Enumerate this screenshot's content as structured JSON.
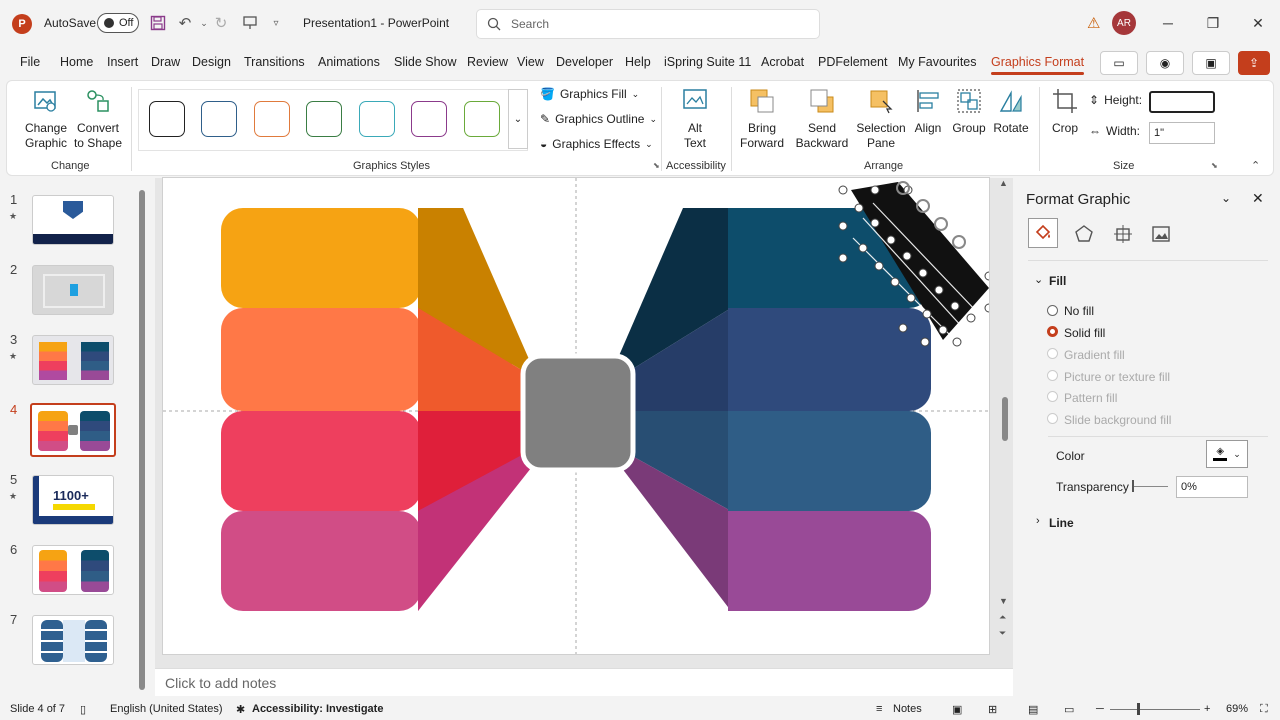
{
  "titlebar": {
    "autosave_label": "AutoSave",
    "autosave_state": "Off",
    "doc_title": "Presentation1 - PowerPoint",
    "search_placeholder": "Search",
    "user_initials": "AR"
  },
  "menu": {
    "tabs": [
      "File",
      "Home",
      "Insert",
      "Draw",
      "Design",
      "Transitions",
      "Animations",
      "Slide Show",
      "Review",
      "View",
      "Developer",
      "Help",
      "iSpring Suite 11",
      "Acrobat",
      "PDFelement",
      "My Favourites",
      "Graphics Format"
    ],
    "active_tab": "Graphics Format"
  },
  "ribbon": {
    "change": {
      "change_graphic": "Change Graphic",
      "convert": "Convert to Shape",
      "label": "Change"
    },
    "styles_label": "Graphics Styles",
    "style_colors": [
      "#222222",
      "#2f5f8a",
      "#e07a3c",
      "#3a7d44",
      "#3aa9b8",
      "#8b3a8b",
      "#6aaa3a"
    ],
    "fill_label": "Graphics Fill",
    "outline_label": "Graphics Outline",
    "effects_label": "Graphics Effects",
    "accessibility": {
      "alt_text": "Alt Text",
      "label": "Accessibility"
    },
    "arrange": {
      "bring_forward": "Bring Forward",
      "send_backward": "Send Backward",
      "selection_pane": "Selection Pane",
      "align": "Align",
      "group": "Group",
      "rotate": "Rotate",
      "label": "Arrange"
    },
    "size": {
      "crop": "Crop",
      "height_label": "Height:",
      "height_value": "",
      "width_label": "Width:",
      "width_value": "1\"",
      "label": "Size"
    }
  },
  "thumbnails": [
    {
      "num": "1",
      "star": true
    },
    {
      "num": "2",
      "star": false
    },
    {
      "num": "3",
      "star": true
    },
    {
      "num": "4",
      "star": false,
      "selected": true
    },
    {
      "num": "5",
      "star": true,
      "thumb_text": "1100+"
    },
    {
      "num": "6",
      "star": false
    },
    {
      "num": "7",
      "star": false
    }
  ],
  "slide": {
    "left_colors": [
      "#f6a313",
      "#ff7847",
      "#ee3f5e",
      "#d14d86"
    ],
    "left_side_colors": [
      "#c98100",
      "#ef5a2c",
      "#df1f3a",
      "#c23277"
    ],
    "right_colors": [
      "#0d4d6b",
      "#2f4a7c",
      "#2f5d86",
      "#994a97"
    ],
    "right_side_colors": [
      "#0b2f45",
      "#263d68",
      "#284e73",
      "#7a3a78"
    ],
    "center_color": "#808080"
  },
  "notes_placeholder": "Click to add notes",
  "format_pane": {
    "title": "Format Graphic",
    "fill_section": "Fill",
    "options": [
      {
        "label": "No fill",
        "state": "off"
      },
      {
        "label": "Solid fill",
        "state": "on"
      },
      {
        "label": "Gradient fill",
        "state": "disabled"
      },
      {
        "label": "Picture or texture fill",
        "state": "disabled"
      },
      {
        "label": "Pattern fill",
        "state": "disabled"
      },
      {
        "label": "Slide background fill",
        "state": "disabled"
      }
    ],
    "color_label": "Color",
    "transparency_label": "Transparency",
    "transparency_value": "0%",
    "line_section": "Line"
  },
  "statusbar": {
    "slide_info": "Slide 4 of 7",
    "language": "English (United States)",
    "accessibility": "Accessibility: Investigate",
    "notes": "Notes",
    "zoom": "69%"
  }
}
